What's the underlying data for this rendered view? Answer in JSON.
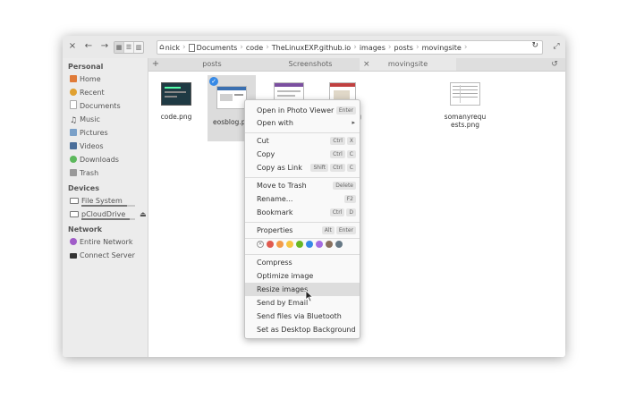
{
  "path": [
    "nick",
    "Documents",
    "code",
    "TheLinuxEXP.github.io",
    "images",
    "posts",
    "movingsite"
  ],
  "icons": {
    "close": "×",
    "back": "←",
    "forward": "→",
    "grid_view": "▦",
    "list_view": "☰",
    "column_view": "▥",
    "home": "⌂",
    "reload": "↻",
    "fullscreen": "⤢",
    "add_tab": "+",
    "tab_close": "×",
    "restore": "↺",
    "submenu": "▸",
    "eject": "⏏",
    "swatch_none": "×"
  },
  "sidebar": {
    "personal_heading": "Personal",
    "personal": [
      {
        "label": "Home",
        "icon": "home-icon",
        "color": "#e07b39"
      },
      {
        "label": "Recent",
        "icon": "recent-icon",
        "color": "#e0a030"
      },
      {
        "label": "Documents",
        "icon": "documents-icon",
        "color": "#cccccc"
      },
      {
        "label": "Music",
        "icon": "music-icon",
        "color": "#555555"
      },
      {
        "label": "Pictures",
        "icon": "pictures-icon",
        "color": "#7aa0c8"
      },
      {
        "label": "Videos",
        "icon": "videos-icon",
        "color": "#4a6e9a"
      },
      {
        "label": "Downloads",
        "icon": "downloads-icon",
        "color": "#5cb85c"
      },
      {
        "label": "Trash",
        "icon": "trash-icon",
        "color": "#999999"
      }
    ],
    "devices_heading": "Devices",
    "devices": [
      {
        "label": "File System",
        "icon": "drive-icon",
        "usage": 0.85
      },
      {
        "label": "pCloudDrive",
        "icon": "drive-icon",
        "usage": 0.9
      }
    ],
    "network_heading": "Network",
    "network": [
      {
        "label": "Entire Network",
        "icon": "network-icon",
        "color": "#a05cc8"
      },
      {
        "label": "Connect Server",
        "icon": "server-icon",
        "color": "#333333"
      }
    ]
  },
  "tabs": [
    {
      "label": "posts",
      "active": false
    },
    {
      "label": "Screenshots",
      "active": false
    },
    {
      "label": "movingsite",
      "active": true
    }
  ],
  "files": [
    {
      "name": "code.png",
      "selected": false
    },
    {
      "name": "eosblog.p",
      "selected": true
    },
    {
      "name": "",
      "selected": false
    },
    {
      "name": "g",
      "selected": false
    },
    {
      "name": "somanyrequests.png",
      "selected": false
    }
  ],
  "context_menu": {
    "items": [
      {
        "label": "Open in Photo Viewer",
        "keys": [
          "Enter"
        ]
      },
      {
        "label": "Open with",
        "submenu": true
      },
      {
        "label": "Cut",
        "keys": [
          "Ctrl",
          "X"
        ]
      },
      {
        "label": "Copy",
        "keys": [
          "Ctrl",
          "C"
        ]
      },
      {
        "label": "Copy as Link",
        "keys": [
          "Shift",
          "Ctrl",
          "C"
        ]
      },
      {
        "label": "Move to Trash",
        "keys": [
          "Delete"
        ]
      },
      {
        "label": "Rename...",
        "keys": [
          "F2"
        ]
      },
      {
        "label": "Bookmark",
        "keys": [
          "Ctrl",
          "D"
        ]
      },
      {
        "label": "Properties",
        "keys": [
          "Alt",
          "Enter"
        ]
      },
      {
        "label": "Compress"
      },
      {
        "label": "Optimize image"
      },
      {
        "label": "Resize images",
        "hover": true
      },
      {
        "label": "Send by Email"
      },
      {
        "label": "Send files via Bluetooth"
      },
      {
        "label": "Set as Desktop Background"
      }
    ],
    "colors": [
      "#e05a4f",
      "#f39c4a",
      "#f5c542",
      "#68b723",
      "#3689e6",
      "#a56de2",
      "#8a715e",
      "#667885"
    ]
  }
}
